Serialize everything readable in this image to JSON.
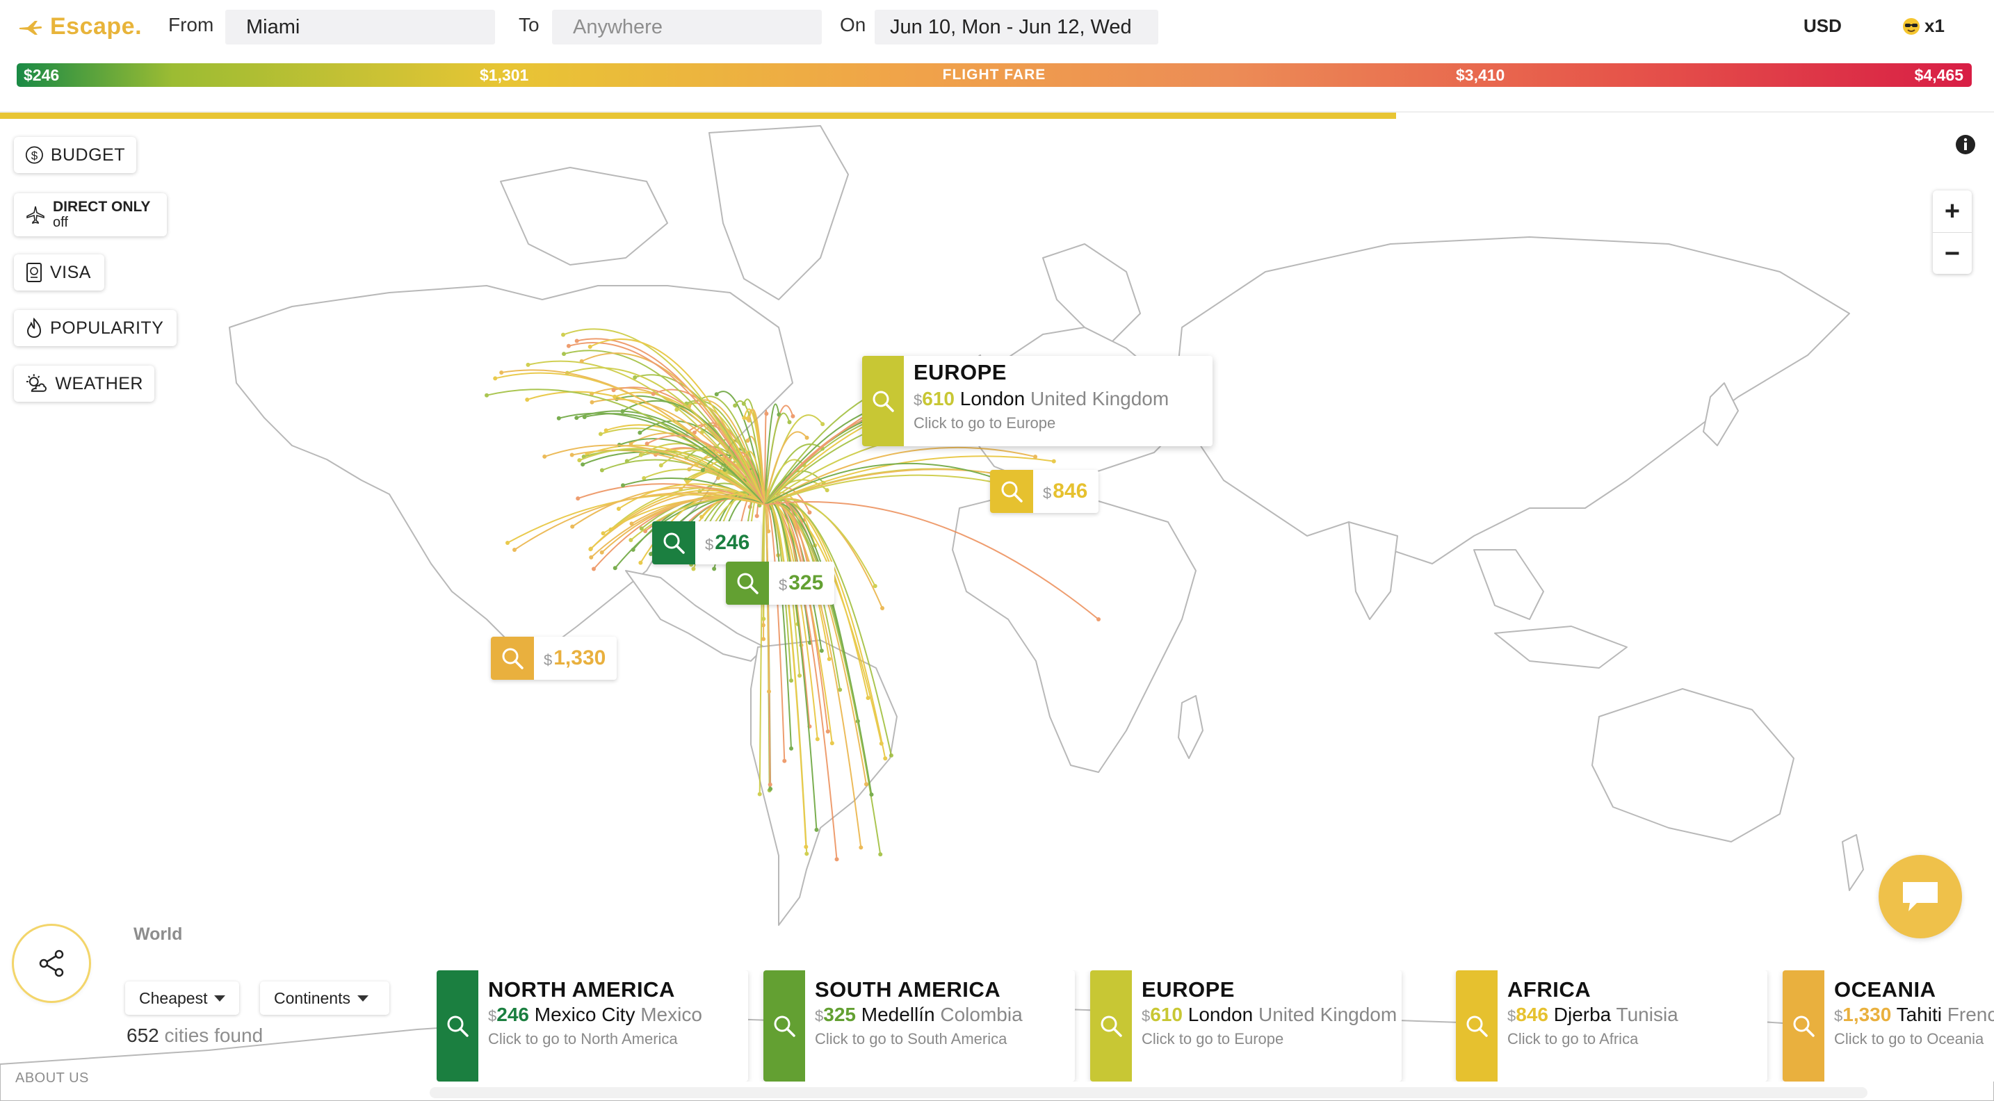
{
  "header": {
    "logo_text": "Escape.",
    "from_label": "From",
    "from_value": "Miami",
    "to_label": "To",
    "to_placeholder": "Anywhere",
    "on_label": "On",
    "dates_value": "Jun 10, Mon - Jun 12, Wed",
    "currency": "USD",
    "travelers": "x1"
  },
  "fare_scale": {
    "title": "FLIGHT FARE",
    "ticks": [
      "$246",
      "$1,301",
      "$3,410",
      "$4,465"
    ],
    "colors": [
      "#1a8a45",
      "#e8c534",
      "#ec8c56",
      "#d81e45"
    ]
  },
  "loading_progress": 0.7,
  "filters": {
    "budget": "BUDGET",
    "direct_only": "DIRECT ONLY",
    "direct_only_state": "off",
    "visa": "VISA",
    "popularity": "POPULARITY",
    "weather": "WEATHER"
  },
  "map_controls": {
    "zoom_in": "+",
    "zoom_out": "−"
  },
  "markers": [
    {
      "currency": "$",
      "price": "246",
      "color": "#1b7f40"
    },
    {
      "currency": "$",
      "price": "325",
      "color": "#63a032"
    },
    {
      "currency": "$",
      "price": "846",
      "color": "#e6c12f"
    },
    {
      "currency": "$",
      "price": "1,330",
      "color": "#e9b03e"
    }
  ],
  "popup": {
    "title": "EUROPE",
    "currency": "$",
    "price": "610",
    "city": "London",
    "country": "United Kingdom",
    "subtitle": "Click to go to Europe",
    "color": "#c8c734"
  },
  "bottom": {
    "region": "World",
    "sort": "Cheapest",
    "group": "Continents",
    "cities_count": "652",
    "cities_label": "cities found",
    "about": "ABOUT US"
  },
  "cards": [
    {
      "title": "NORTH AMERICA",
      "currency": "$",
      "price": "246",
      "city": "Mexico City",
      "country": "Mexico",
      "subtitle": "Click to go to North America",
      "color": "#1b7f40"
    },
    {
      "title": "SOUTH AMERICA",
      "currency": "$",
      "price": "325",
      "city": "Medellín",
      "country": "Colombia",
      "subtitle": "Click to go to South America",
      "color": "#63a032"
    },
    {
      "title": "EUROPE",
      "currency": "$",
      "price": "610",
      "city": "London",
      "country": "United Kingdom",
      "subtitle": "Click to go to Europe",
      "color": "#c8c734"
    },
    {
      "title": "AFRICA",
      "currency": "$",
      "price": "846",
      "city": "Djerba",
      "country": "Tunisia",
      "subtitle": "Click to go to Africa",
      "color": "#e6c12f"
    },
    {
      "title": "OCEANIA",
      "currency": "$",
      "price": "1,330",
      "city": "Tahiti",
      "country": "French Polynesia",
      "subtitle": "Click to go to Oceania",
      "color": "#e9b03e"
    }
  ]
}
